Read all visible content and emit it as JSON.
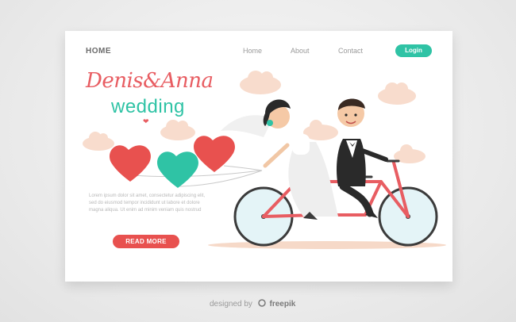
{
  "nav": {
    "home": "HOME",
    "links": [
      "Home",
      "About",
      "Contact"
    ],
    "login": "Login"
  },
  "hero": {
    "names": "Denis&Anna",
    "subtitle": "wedding",
    "body": "Lorem ipsum dolor sit amet, consectetur adipiscing elit, sed do eiusmod tempor incididunt ut labore et dolore magna aliqua. Ut enim ad minim veniam quis nostrud",
    "button": "READ MORE"
  },
  "footer": {
    "credit_prefix": "designed by",
    "brand": "freepik"
  },
  "colors": {
    "accent_teal": "#2fc3a5",
    "accent_red": "#e85d62",
    "balloon_red": "#e8514f",
    "cloud": "#f8dccd",
    "bike_frame": "#e85d62",
    "wheel": "#d6eef2"
  },
  "icons": [
    "heart-icon",
    "freepik-logo-icon"
  ]
}
